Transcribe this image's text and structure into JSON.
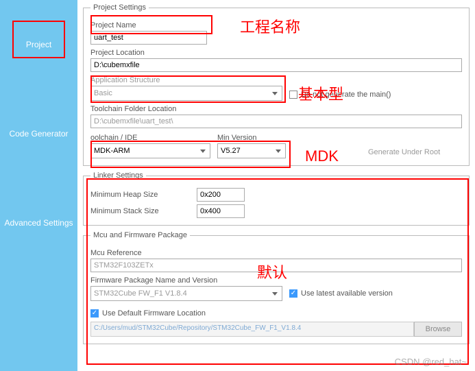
{
  "sidebar": {
    "items": [
      {
        "label": "Project"
      },
      {
        "label": "Code Generator"
      },
      {
        "label": "Advanced Settings"
      }
    ]
  },
  "projectSettings": {
    "legend": "Project Settings",
    "projectName": {
      "label": "Project Name",
      "value": "uart_test"
    },
    "projectLocation": {
      "label": "Project Location",
      "value": "D:\\cubemxfile"
    },
    "appStructure": {
      "label": "Application Structure",
      "value": "Basic"
    },
    "dontGenMain": {
      "label": "Do not generate the main()"
    },
    "toolchainFolder": {
      "label": "Toolchain Folder Location",
      "value": "D:\\cubemxfile\\uart_test\\"
    },
    "toolchain": {
      "label": "oolchain / IDE",
      "value": "MDK-ARM"
    },
    "minVersion": {
      "label": "Min Version",
      "value": "V5.27"
    },
    "generateUnderRoot": {
      "label": "Generate Under Root"
    }
  },
  "linker": {
    "legend": "Linker Settings",
    "heap": {
      "label": "Minimum Heap Size",
      "value": "0x200"
    },
    "stack": {
      "label": "Minimum Stack Size",
      "value": "0x400"
    }
  },
  "mcu": {
    "legend": "Mcu and Firmware Package",
    "reference": {
      "label": "Mcu Reference",
      "value": "STM32F103ZETx"
    },
    "fwPackage": {
      "label": "Firmware Package Name and Version",
      "value": "STM32Cube FW_F1 V1.8.4"
    },
    "useLatest": {
      "label": "Use latest available version"
    },
    "useDefault": {
      "label": "Use Default Firmware Location"
    },
    "path": "C:/Users/mud/STM32Cube/Repository/STM32Cube_FW_F1_V1.8.4",
    "browse": "Browse"
  },
  "annotations": {
    "projectName": "工程名称",
    "basic": "基本型",
    "mdk": "MDK",
    "default": "默认"
  },
  "watermark": "CSDN @red_hat~"
}
